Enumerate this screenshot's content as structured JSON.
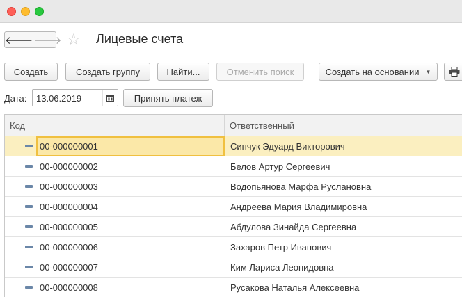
{
  "window": {
    "title": "Лицевые счета"
  },
  "toolbar": {
    "create": "Создать",
    "create_group": "Создать группу",
    "find": "Найти...",
    "cancel_search": "Отменить поиск",
    "create_based_on": "Создать на основании"
  },
  "filter": {
    "date_label": "Дата:",
    "date_value": "13.06.2019",
    "accept_payment": "Принять платеж"
  },
  "table": {
    "columns": [
      "Код",
      "Ответственный"
    ],
    "rows": [
      {
        "code": "00-000000001",
        "responsible": "Сипчук Эдуард Викторович"
      },
      {
        "code": "00-000000002",
        "responsible": "Белов Артур Сергеевич"
      },
      {
        "code": "00-000000003",
        "responsible": "Водопьянова Марфа Руслановна"
      },
      {
        "code": "00-000000004",
        "responsible": "Андреева Мария Владимировна"
      },
      {
        "code": "00-000000005",
        "responsible": "Абдулова Зинайда Сергеевна"
      },
      {
        "code": "00-000000006",
        "responsible": "Захаров Петр Иванович"
      },
      {
        "code": "00-000000007",
        "responsible": "Ким Лариса Леонидовна"
      },
      {
        "code": "00-000000008",
        "responsible": "Русакова Наталья Алексеевна"
      }
    ]
  },
  "colors": {
    "selected_row": "#fbefc0",
    "selected_cell_border": "#f0c040",
    "row_icon": "#6b87a8"
  },
  "icons": [
    "back-arrow-icon",
    "forward-arrow-icon",
    "favorite-star-icon",
    "calendar-icon",
    "print-icon",
    "dropdown-arrow-icon"
  ]
}
